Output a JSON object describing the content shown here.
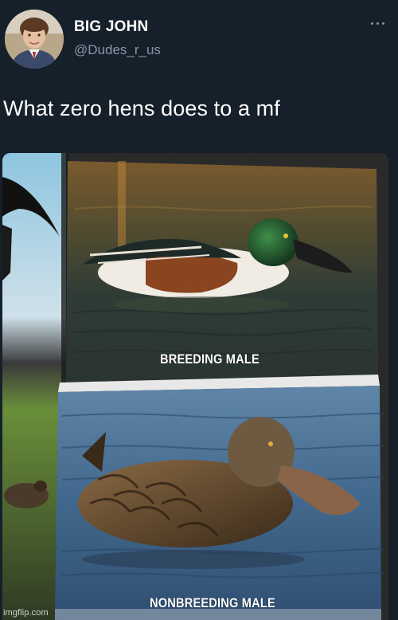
{
  "tweet": {
    "display_name": "BIG JOHN",
    "handle": "@Dudes_r_us",
    "text": "What zero hens does to a mf",
    "more_icon": "more-horizontal-icon"
  },
  "media": {
    "top_caption": "BREEDING MALE",
    "bottom_caption": "NONBREEDING MALE"
  },
  "watermark": "imgflip.com",
  "colors": {
    "background": "#15202b",
    "handle": "#8899a6",
    "text": "#ffffff"
  }
}
